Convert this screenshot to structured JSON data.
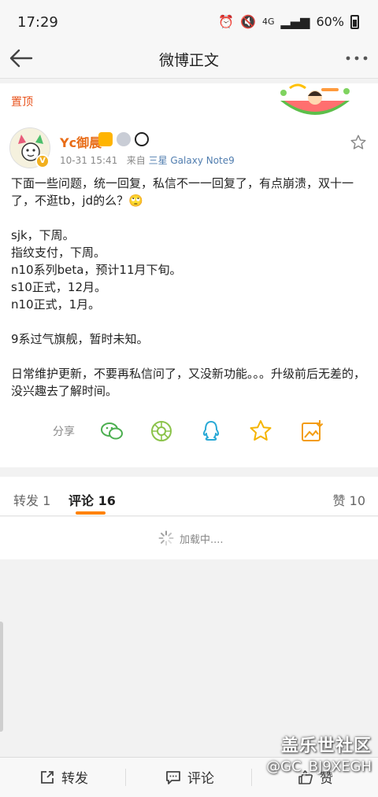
{
  "status": {
    "time": "17:29",
    "network": "4G",
    "battery": "60%"
  },
  "nav": {
    "title": "微博正文"
  },
  "post": {
    "pinned": "置顶",
    "username": "Yc御晨",
    "time": "10-31 15:41",
    "source_prefix": "来自",
    "source": "三星 Galaxy Note9",
    "content": "下面一些问题，统一回复，私信不一一回复了，有点崩溃，双十一了，不逛tb，jd的么？🙄\n\nsjk，下周。\n指纹支付，下周。\nn10系列beta，预计11月下旬。\ns10正式，12月。\nn10正式，1月。\n\n9系过气旗舰，暂时未知。\n\n日常维护更新，不要再私信问了，又没新功能。。。升级前后无差的，没兴趣去了解时间。"
  },
  "share": {
    "label": "分享",
    "icons": [
      "wechat-icon",
      "moments-icon",
      "qq-icon",
      "qzone-star-icon",
      "save-image-icon"
    ]
  },
  "tabs": {
    "repost": "转发 1",
    "comment": "评论 16",
    "like": "赞 10"
  },
  "loading": {
    "text": "加载中...."
  },
  "bottom": {
    "repost": "转发",
    "comment": "评论",
    "like": "赞"
  },
  "watermark": {
    "line1": "盖乐世社区",
    "line2": "@GC_BJ9XEGH"
  },
  "colors": {
    "accent": "#ff8200",
    "username": "#e86c17",
    "pinned": "#e8541e",
    "link": "#507daf"
  }
}
